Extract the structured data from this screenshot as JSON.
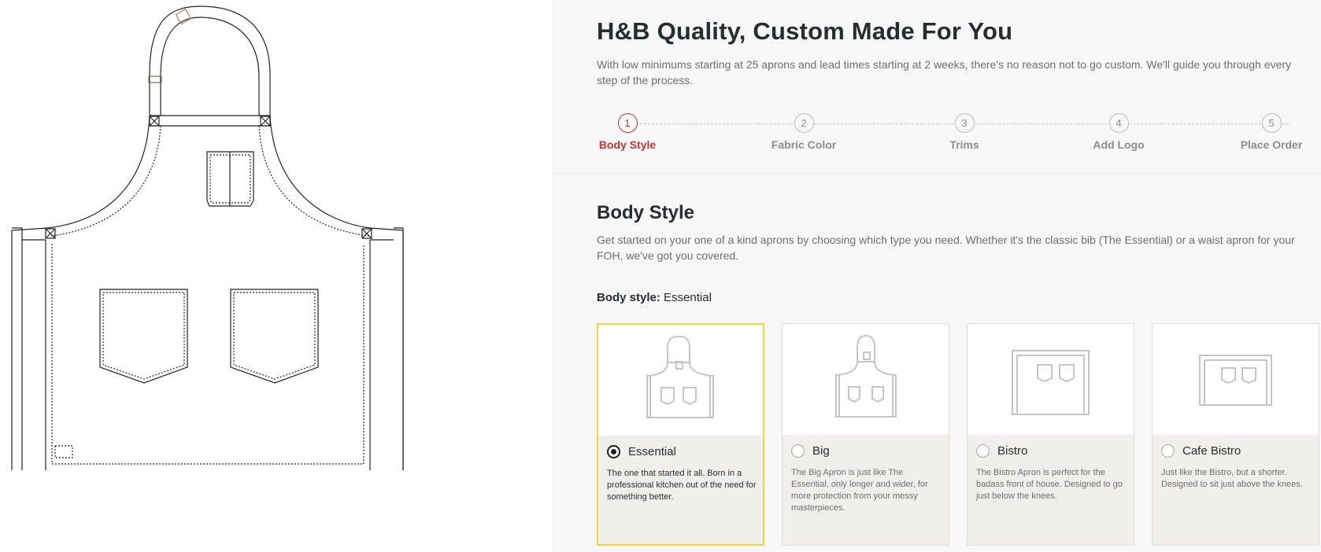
{
  "header": {
    "title": "H&B Quality, Custom Made For You",
    "subtitle": "With low minimums starting at 25 aprons and lead times starting at 2 weeks, there's no reason not to go custom. We'll guide you through every step of the process."
  },
  "stepper": {
    "steps": [
      {
        "number": "1",
        "label": "Body Style",
        "active": true
      },
      {
        "number": "2",
        "label": "Fabric Color",
        "active": false
      },
      {
        "number": "3",
        "label": "Trims",
        "active": false
      },
      {
        "number": "4",
        "label": "Add Logo",
        "active": false
      },
      {
        "number": "5",
        "label": "Place Order",
        "active": false
      }
    ]
  },
  "section": {
    "title": "Body Style",
    "description": "Get started on your one of a kind aprons by choosing which type you need. Whether it's the classic bib (The Essential) or a waist apron for your FOH, we've got you covered.",
    "selected_label": "Body style:",
    "selected_value": "Essential"
  },
  "options": [
    {
      "name": "Essential",
      "description": "The one that started it all. Born in a professional kitchen out of the need for something better.",
      "selected": true,
      "icon": "bib-apron-icon"
    },
    {
      "name": "Big",
      "description": "The Big Apron is just like The Essential, only longer and wider, for more protection from your messy masterpieces.",
      "selected": false,
      "icon": "big-apron-icon"
    },
    {
      "name": "Bistro",
      "description": "The Bistro Apron is perfect for the badass front of house. Designed to go just below the knees.",
      "selected": false,
      "icon": "bistro-apron-icon"
    },
    {
      "name": "Cafe Bistro",
      "description": "Just like the Bistro, but a shorter. Designed to sit just above the knees.",
      "selected": false,
      "icon": "cafe-bistro-apron-icon"
    }
  ],
  "colors": {
    "accent_red": "#c8342e",
    "selected_border": "#f2d639",
    "card_bg": "#f1efec",
    "title_text": "#262d31"
  }
}
